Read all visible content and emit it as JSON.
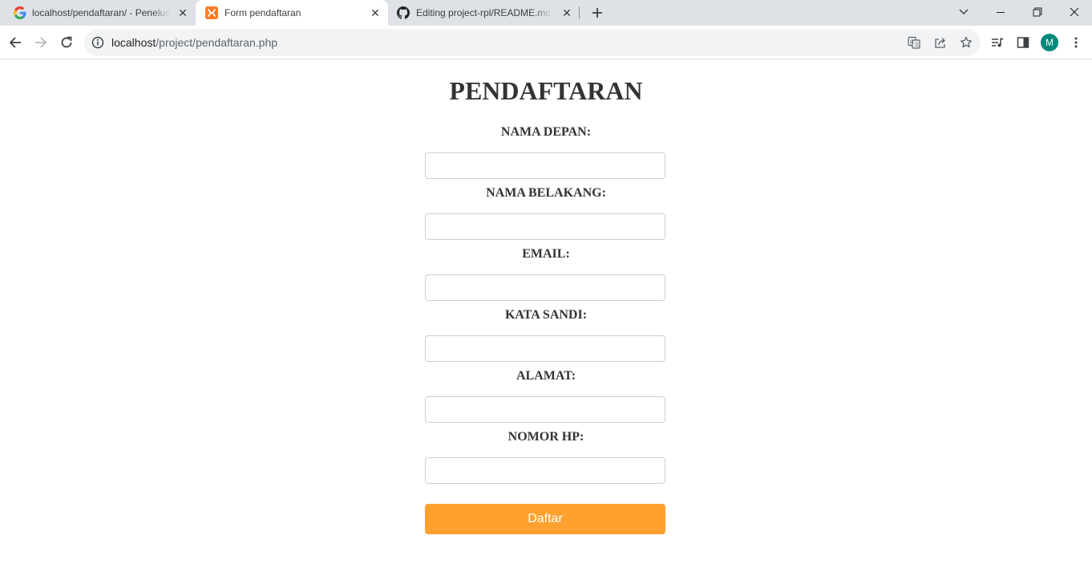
{
  "browser": {
    "tabs": [
      {
        "title": "localhost/pendaftaran/ - Penelusuran Google",
        "favicon": "google-g-icon",
        "active": false
      },
      {
        "title": "Form pendaftaran",
        "favicon": "xampp-icon",
        "active": true
      },
      {
        "title": "Editing project-rpl/README.md",
        "favicon": "github-icon",
        "active": false
      }
    ],
    "address": {
      "host": "localhost",
      "path": "/project/pendaftaran.php"
    },
    "profile_initial": "M",
    "colors": {
      "tabstrip": "#dee1e6",
      "avatar": "#00897b",
      "xampp": "#fb7a24"
    }
  },
  "form": {
    "title": "PENDAFTARAN",
    "fields": [
      {
        "label": "NAMA DEPAN:",
        "value": ""
      },
      {
        "label": "NAMA BELAKANG:",
        "value": ""
      },
      {
        "label": "EMAIL:",
        "value": ""
      },
      {
        "label": "KATA SANDI:",
        "value": ""
      },
      {
        "label": "ALAMAT:",
        "value": ""
      },
      {
        "label": "NOMOR HP:",
        "value": ""
      }
    ],
    "submit_label": "Daftar",
    "colors": {
      "submit": "#ffa12f",
      "text": "#333333"
    }
  }
}
